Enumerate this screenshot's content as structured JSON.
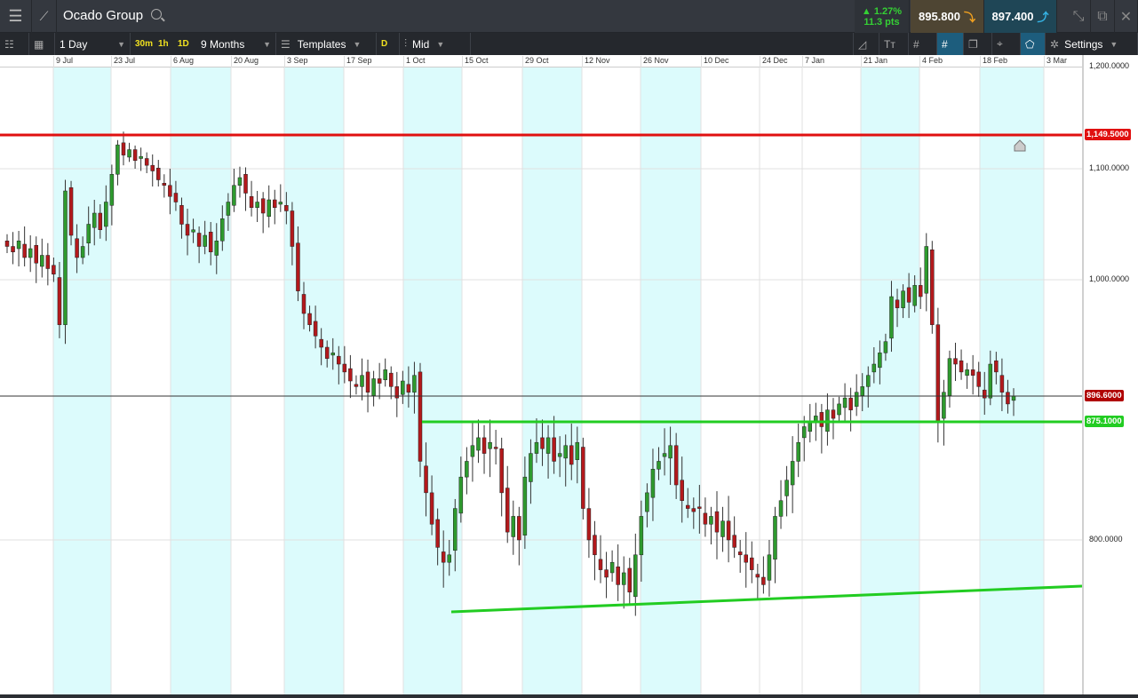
{
  "header": {
    "title": "Ocado Group",
    "change_pct": "▲ 1.27%",
    "change_pts": "11.3 pts",
    "sell_price": "895.800",
    "buy_price": "897.400"
  },
  "toolbar": {
    "interval": "1 Day",
    "quick_30m": "30m",
    "quick_1h": "1h",
    "quick_1d": "1D",
    "range": "9 Months",
    "templates": "Templates",
    "d_label": "D",
    "price_type": "Mid",
    "settings": "Settings",
    "text_tool": "Tт"
  },
  "colors": {
    "up": "#2e9a2e",
    "down": "#b3191c",
    "resistance": "#e01010",
    "support": "#22cc22",
    "shade": "#dcfbfc"
  },
  "chart_data": {
    "type": "candlestick",
    "x_tick_labels": [
      "9 Jul",
      "23 Jul",
      "6 Aug",
      "20 Aug",
      "3 Sep",
      "17 Sep",
      "1 Oct",
      "15 Oct",
      "29 Oct",
      "12 Nov",
      "26 Nov",
      "10 Dec",
      "24 Dec",
      "7 Jan",
      "21 Jan",
      "4 Feb",
      "18 Feb",
      "3 Mar"
    ],
    "y_tick_labels": [
      "1,200.0000",
      "1,100.0000",
      "1,000.0000",
      "800.0000"
    ],
    "y_ticks": [
      1200,
      1100,
      1000,
      800
    ],
    "ylim": [
      718,
      1250
    ],
    "closes_note": "daily candles, open = previous close",
    "closes": [
      1030,
      1025,
      1035,
      1020,
      1028,
      1015,
      1022,
      1010,
      1005,
      960,
      1080,
      1040,
      1020,
      1030,
      1050,
      1060,
      1045,
      1070,
      1095,
      1135,
      1120,
      1128,
      1112,
      1118,
      1105,
      1098,
      1090,
      1085,
      1075,
      1070,
      1050,
      1040,
      1045,
      1030,
      1040,
      1025,
      1035,
      1055,
      1070,
      1085,
      1092,
      1078,
      1065,
      1070,
      1060,
      1072,
      1065,
      1070,
      1062,
      1030,
      990,
      970,
      960,
      950,
      940,
      930,
      935,
      925,
      918,
      910,
      905,
      915,
      900,
      912,
      908,
      920,
      905,
      895,
      910,
      900,
      915,
      850,
      830,
      810,
      795,
      785,
      790,
      820,
      840,
      850,
      860,
      865,
      855,
      862,
      858,
      830,
      805,
      815,
      800,
      840,
      855,
      862,
      858,
      865,
      850,
      855,
      860,
      848,
      862,
      820,
      800,
      790,
      780,
      775,
      785,
      770,
      778,
      765,
      790,
      815,
      830,
      845,
      850,
      855,
      860,
      835,
      825,
      820,
      818,
      820,
      810,
      815,
      805,
      812,
      800,
      795,
      790,
      785,
      780,
      775,
      770,
      790,
      815,
      825,
      838,
      850,
      862,
      872,
      875,
      880,
      872,
      885,
      878,
      890,
      895,
      885,
      900,
      905,
      915,
      925,
      935,
      945,
      985,
      975,
      990,
      980,
      995,
      985,
      1030,
      960,
      875,
      900,
      930,
      925,
      918,
      920,
      915,
      905,
      895,
      925,
      918,
      900,
      890,
      896.6
    ],
    "lines": {
      "resistance": {
        "value": 1149.5,
        "label": "1,149.5000"
      },
      "current": {
        "value": 896.6,
        "label": "896.6000"
      },
      "support": {
        "value": 875.1,
        "label": "875.1000"
      },
      "rising_trendline": {
        "from": 770,
        "to": 787
      }
    }
  }
}
